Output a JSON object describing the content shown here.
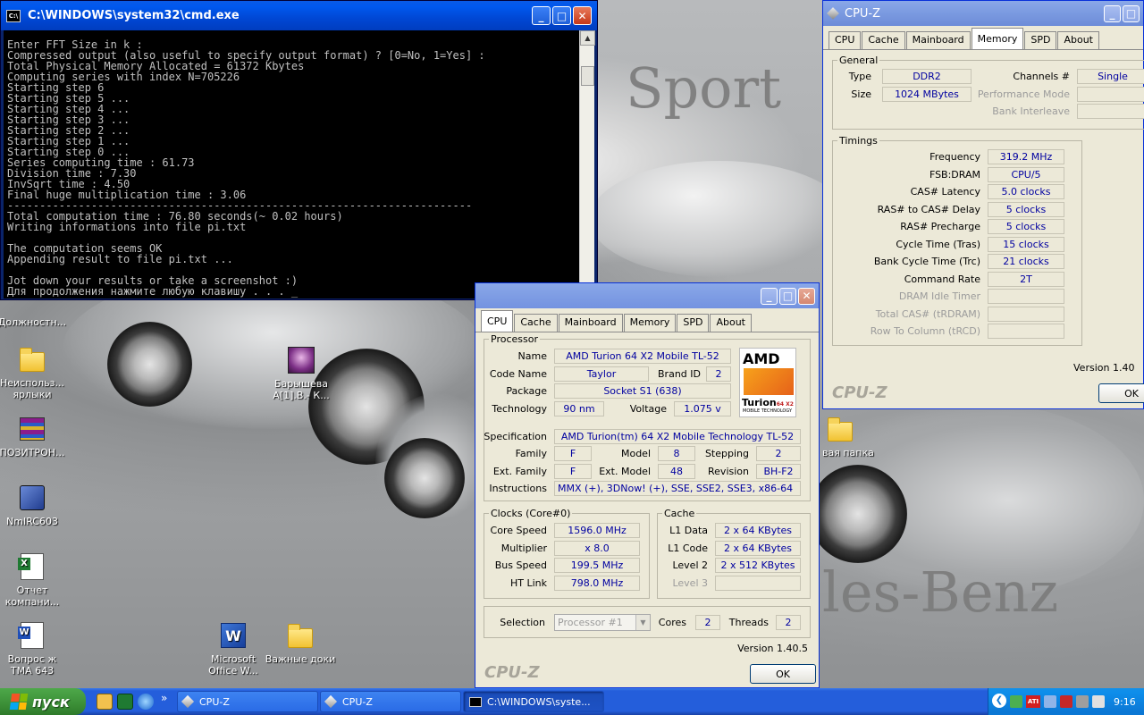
{
  "colors": {
    "xp_blue": "#0058ee",
    "cmd_bg": "#000000",
    "cmd_fg": "#c0c0c0",
    "cpuz_value": "#0000a0",
    "cpuz_bg": "#ece9d8",
    "start_green": "#3c8f37"
  },
  "wallpaper": {
    "text_sport": "Sport",
    "text_benz": "les-Benz"
  },
  "desktop_icons": [
    {
      "label": "Должностн...",
      "icon": "document-icon"
    },
    {
      "label": "Неиспольз... ярлыки",
      "icon": "folder-icon"
    },
    {
      "label": "ПОЗИТРОН...",
      "icon": "winrar-icon"
    },
    {
      "label": "NmIRC603",
      "icon": "program-icon"
    },
    {
      "label": "Отчет компани...",
      "icon": "excel-icon"
    },
    {
      "label": "Вопрос ж ТМА 643",
      "icon": "word-icon"
    },
    {
      "label": "Барышева А[1].В.- К...",
      "icon": "image-icon"
    },
    {
      "label": "Microsoft Office W...",
      "icon": "word-shortcut-icon"
    },
    {
      "label": "Важные доки",
      "icon": "folder-icon"
    },
    {
      "label": "вая папка",
      "icon": "folder-icon"
    }
  ],
  "cmd": {
    "title": "C:\\WINDOWS\\system32\\cmd.exe",
    "lines": [
      "Enter FFT Size in k :",
      "Compressed output (also useful to specify output format) ? [0=No, 1=Yes] :",
      "Total Physical Memory Allocated = 61372 Kbytes",
      "Computing series with index N=705226",
      "Starting step 6",
      "Starting step 5 ...",
      "Starting step 4 ...",
      "Starting step 3 ...",
      "Starting step 2 ...",
      "Starting step 1 ...",
      "Starting step 0 ...",
      "Series computing time : 61.73",
      "Division time : 7.30",
      "InvSqrt time : 4.50",
      "Final huge multiplication time : 3.06",
      "------------------------------------------------------------------------",
      "Total computation time : 76.80 seconds(~ 0.02 hours)",
      "Writing informations into file pi.txt",
      "",
      "The computation seems OK",
      "Appending result to file pi.txt ...",
      "",
      "Jot down your results or take a screenshot :)",
      "Для продолжения нажмите любую клавишу . . . _"
    ]
  },
  "cpuz_memory": {
    "title": "CPU-Z",
    "tabs": [
      "CPU",
      "Cache",
      "Mainboard",
      "Memory",
      "SPD",
      "About"
    ],
    "active_tab": "Memory",
    "general": {
      "legend": "General",
      "type_label": "Type",
      "type": "DDR2",
      "size_label": "Size",
      "size": "1024 MBytes",
      "channels_label": "Channels #",
      "channels": "Single",
      "perf_label": "Performance Mode",
      "bank_label": "Bank Interleave"
    },
    "timings": {
      "legend": "Timings",
      "rows": [
        {
          "label": "Frequency",
          "value": "319.2 MHz",
          "dim": false
        },
        {
          "label": "FSB:DRAM",
          "value": "CPU/5",
          "dim": false
        },
        {
          "label": "CAS# Latency",
          "value": "5.0 clocks",
          "dim": false
        },
        {
          "label": "RAS# to CAS# Delay",
          "value": "5 clocks",
          "dim": false
        },
        {
          "label": "RAS# Precharge",
          "value": "5 clocks",
          "dim": false
        },
        {
          "label": "Cycle Time (Tras)",
          "value": "15 clocks",
          "dim": false
        },
        {
          "label": "Bank Cycle Time (Trc)",
          "value": "21 clocks",
          "dim": false
        },
        {
          "label": "Command Rate",
          "value": "2T",
          "dim": false
        },
        {
          "label": "DRAM Idle Timer",
          "value": "",
          "dim": true
        },
        {
          "label": "Total CAS# (tRDRAM)",
          "value": "",
          "dim": true
        },
        {
          "label": "Row To Column (tRCD)",
          "value": "",
          "dim": true
        }
      ]
    },
    "version": "Version 1.40",
    "logo": "CPU-Z",
    "ok": "OK"
  },
  "cpuz_cpu": {
    "tabs": [
      "CPU",
      "Cache",
      "Mainboard",
      "Memory",
      "SPD",
      "About"
    ],
    "active_tab": "CPU",
    "processor": {
      "legend": "Processor",
      "name_label": "Name",
      "name": "AMD Turion 64 X2 Mobile TL-52",
      "codename_label": "Code Name",
      "codename": "Taylor",
      "brandid_label": "Brand ID",
      "brandid": "2",
      "package_label": "Package",
      "package": "Socket S1 (638)",
      "tech_label": "Technology",
      "tech": "90 nm",
      "voltage_label": "Voltage",
      "voltage": "1.075 v",
      "spec_label": "Specification",
      "spec": "AMD Turion(tm) 64 X2 Mobile Technology TL-52",
      "family_label": "Family",
      "family": "F",
      "model_label": "Model",
      "model": "8",
      "stepping_label": "Stepping",
      "stepping": "2",
      "extfamily_label": "Ext. Family",
      "extfamily": "F",
      "extmodel_label": "Ext. Model",
      "extmodel": "48",
      "revision_label": "Revision",
      "revision": "BH-F2",
      "instr_label": "Instructions",
      "instr": "MMX (+), 3DNow! (+), SSE, SSE2, SSE3, x86-64",
      "logo_amd": "AMD",
      "logo_turion": "Turion",
      "logo_x2": "64 X2",
      "logo_sub": "MOBILE TECHNOLOGY"
    },
    "clocks": {
      "legend": "Clocks (Core#0)",
      "core_label": "Core Speed",
      "core": "1596.0 MHz",
      "mult_label": "Multiplier",
      "mult": "x 8.0",
      "bus_label": "Bus Speed",
      "bus": "199.5 MHz",
      "ht_label": "HT Link",
      "ht": "798.0 MHz"
    },
    "cache": {
      "legend": "Cache",
      "l1d_label": "L1 Data",
      "l1d": "2 x 64 KBytes",
      "l1c_label": "L1 Code",
      "l1c": "2 x 64 KBytes",
      "l2_label": "Level 2",
      "l2": "2 x 512 KBytes",
      "l3_label": "Level 3"
    },
    "selection_label": "Selection",
    "selection": "Processor #1",
    "cores_label": "Cores",
    "cores": "2",
    "threads_label": "Threads",
    "threads": "2",
    "version": "Version 1.40.5",
    "logo": "CPU-Z",
    "ok": "OK"
  },
  "taskbar": {
    "start": "пуск",
    "tasks": [
      {
        "label": "CPU-Z",
        "active": false
      },
      {
        "label": "CPU-Z",
        "active": false
      },
      {
        "label": "C:\\WINDOWS\\syste...",
        "active": true
      }
    ],
    "clock": "9:16",
    "quick_more": "»",
    "tray_badge": "ATI"
  }
}
